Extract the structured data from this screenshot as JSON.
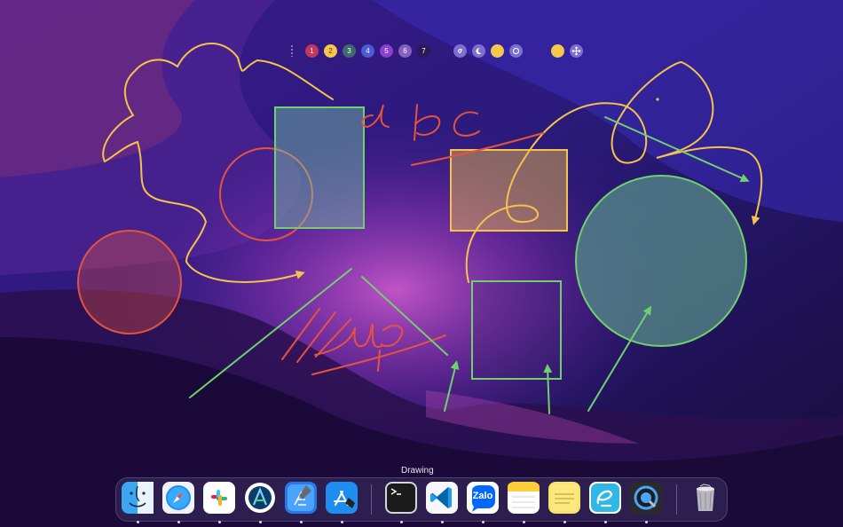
{
  "toolbar": {
    "grip_icon": "grip-dots-icon",
    "number_buttons": [
      {
        "label": "1",
        "color": "#c0395a"
      },
      {
        "label": "2",
        "color": "#f5c84a"
      },
      {
        "label": "3",
        "color": "#3f6a6a"
      },
      {
        "label": "4",
        "color": "#4b5ad6"
      },
      {
        "label": "5",
        "color": "#8a3fd1"
      },
      {
        "label": "6",
        "color": "#8560c0"
      },
      {
        "label": "7",
        "color": "#2a1a55"
      }
    ],
    "tool_buttons": [
      {
        "icon": "spiral-icon",
        "color": "#7d6fd0"
      },
      {
        "icon": "moon-icon",
        "color": "#7d6fd0"
      },
      {
        "icon": "yellow-dot-icon",
        "color": "#f5c84a"
      },
      {
        "icon": "ring-icon",
        "color": "#7d6fd0"
      }
    ],
    "extra_buttons": [
      {
        "icon": "color-swatch-icon",
        "color": "#f5c84a"
      },
      {
        "icon": "move-arrows-icon",
        "color": "#7d6fd0"
      }
    ]
  },
  "canvas": {
    "colors": {
      "yellow": "#f5c34a",
      "green": "#6fd16e",
      "red": "#e5533f"
    }
  },
  "dock": {
    "tooltip": "Drawing",
    "apps": [
      {
        "name": "Finder",
        "icon": "finder-icon",
        "running": true
      },
      {
        "name": "Safari",
        "icon": "safari-icon",
        "running": true
      },
      {
        "name": "Slack",
        "icon": "slack-icon",
        "running": true
      },
      {
        "name": "Android Studio",
        "icon": "android-studio-icon",
        "running": true
      },
      {
        "name": "Xcode",
        "icon": "xcode-icon",
        "running": true
      },
      {
        "name": "App Store",
        "icon": "app-store-icon",
        "running": true
      },
      {
        "name": "Terminal",
        "icon": "terminal-icon",
        "running": true
      },
      {
        "name": "Visual Studio Code",
        "icon": "vscode-icon",
        "running": true
      },
      {
        "name": "Zalo",
        "icon": "zalo-icon",
        "label": "Zalo",
        "running": true
      },
      {
        "name": "Notes",
        "icon": "notes-icon",
        "running": true
      },
      {
        "name": "Stickies",
        "icon": "stickies-icon",
        "running": true
      },
      {
        "name": "Drawing",
        "icon": "drawing-app-icon",
        "running": true
      },
      {
        "name": "QuickTime Player",
        "icon": "quicktime-icon",
        "running": true
      },
      {
        "name": "Trash",
        "icon": "trash-icon",
        "running": false
      }
    ]
  }
}
